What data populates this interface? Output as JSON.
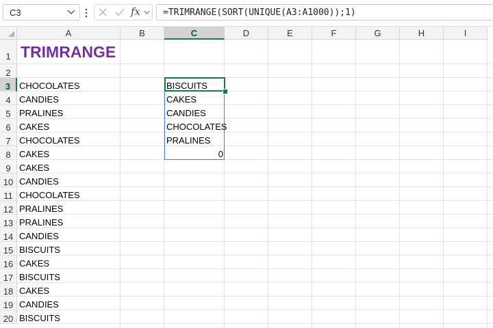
{
  "formula_bar": {
    "name_box": "C3",
    "fx_label": "fx",
    "formula": "=TRIMRANGE(SORT(UNIQUE(A3:A1000));1)"
  },
  "columns": [
    "A",
    "B",
    "C",
    "D",
    "E",
    "F",
    "G",
    "H",
    "I"
  ],
  "active_column": "C",
  "rows": [
    "1",
    "2",
    "3",
    "4",
    "5",
    "6",
    "7",
    "8",
    "9",
    "10",
    "11",
    "12",
    "13",
    "14",
    "15",
    "16",
    "17",
    "18",
    "19",
    "20"
  ],
  "active_row": "3",
  "cells": {
    "A1": "TRIMRANGE",
    "A": [
      "CHOCOLATES",
      "CANDIES",
      "PRALINES",
      "CAKES",
      "CHOCOLATES",
      "CAKES",
      "CAKES",
      "CANDIES",
      "CHOCOLATES",
      "PRALINES",
      "PRALINES",
      "CANDIES",
      "BISCUITS",
      "CAKES",
      "BISCUITS",
      "CAKES",
      "CANDIES",
      "BISCUITS"
    ],
    "C": [
      "BISCUITS",
      "CAKES",
      "CANDIES",
      "CHOCOLATES",
      "PRALINES"
    ],
    "C8": "0"
  },
  "colors": {
    "title": "#7030a0",
    "selection": "#107c41",
    "spill_border": "#4a7bd4"
  },
  "icons": {
    "name_box_dropdown": "chevron-down-icon",
    "more": "vertical-dots-icon",
    "cancel": "x-icon",
    "enter": "check-icon",
    "fx_dropdown": "chevron-down-icon",
    "select_all": "triangle-icon"
  }
}
